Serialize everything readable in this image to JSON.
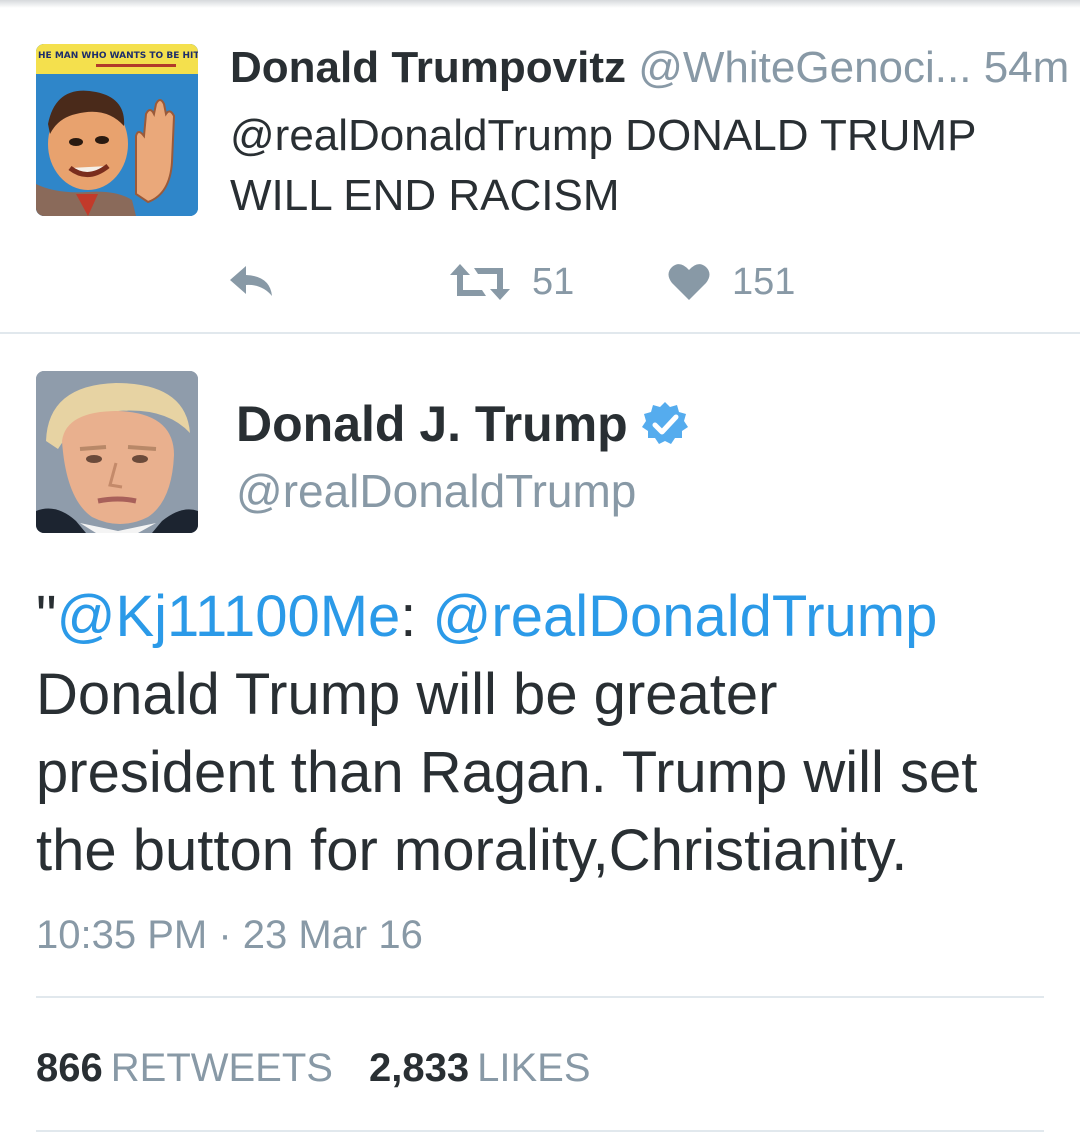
{
  "reply_tweet": {
    "display_name": "Donald Trumpovitz",
    "handle": "@WhiteGenoci...",
    "time_ago": "54m",
    "text": "@realDonaldTrump DONALD TRUMP WILL END RACISM",
    "avatar_caption": "HE MAN WHO WANTS TO BE HITLE",
    "retweet_count": "51",
    "like_count": "151",
    "icons": [
      "reply-icon",
      "retweet-icon",
      "heart-icon"
    ]
  },
  "main_tweet": {
    "display_name": "Donald J. Trump",
    "handle": "@realDonaldTrump",
    "verified": true,
    "text": {
      "open_quote": "\"",
      "mention_1": "@Kj11100Me",
      "colon": ": ",
      "mention_2": "@realDonaldTrump",
      "line_2": "Donald Trump will be greater",
      "line_3": "president than Ragan. Trump will set",
      "line_4": "the button for morality,Christianity."
    },
    "timestamp": "10:35 PM · 23 Mar 16",
    "retweets_count": "866",
    "retweets_label": "RETWEETS",
    "likes_count": "2,833",
    "likes_label": "LIKES"
  },
  "colors": {
    "link_blue": "#2b9ae8",
    "meta_gray": "#8899a6",
    "text_dark": "#292f33",
    "verified_blue": "#55acee",
    "divider": "#e1e8ed"
  }
}
